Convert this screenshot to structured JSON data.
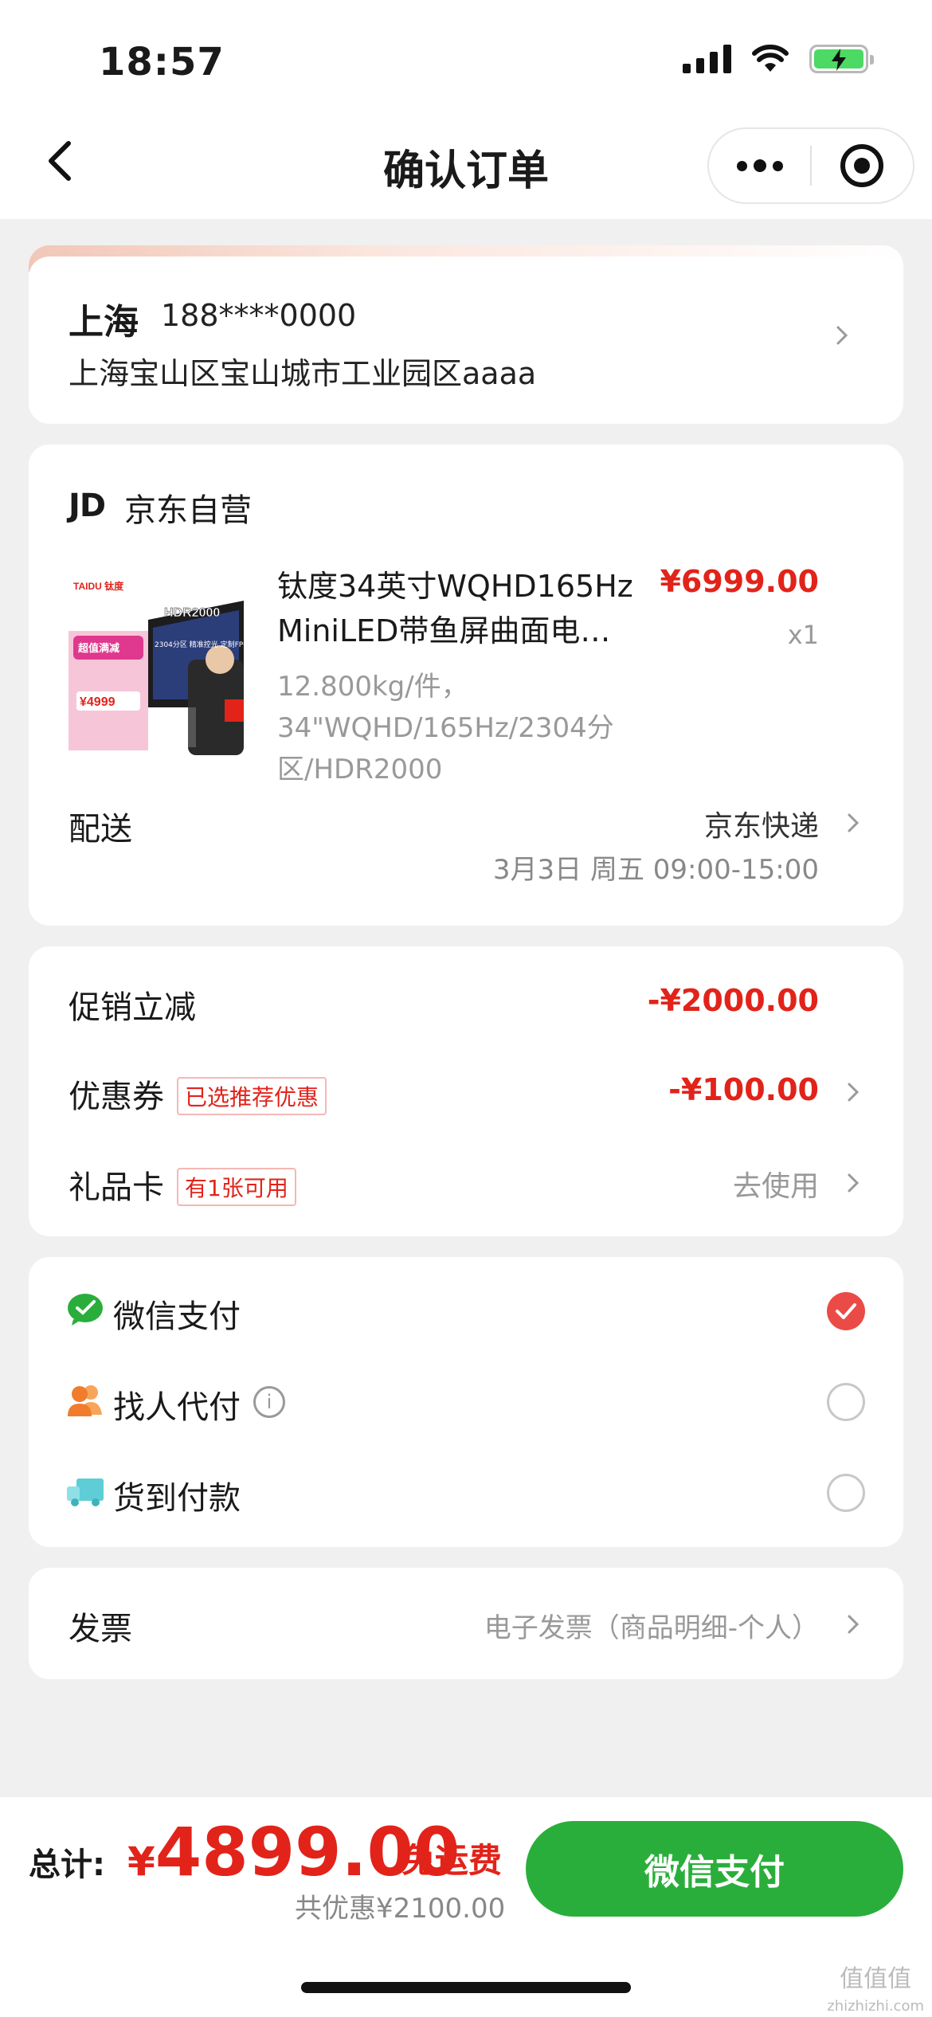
{
  "status_bar": {
    "time": "18:57"
  },
  "nav": {
    "title": "确认订单"
  },
  "address": {
    "city": "上海",
    "phone": "188****0000",
    "detail": "上海宝山区宝山城市工业园区aaaa"
  },
  "product": {
    "shop_logo": "JD",
    "shop_name": "京东自营",
    "title": "钛度34英寸WQHD165Hz MiniLED带鱼屏曲面电…",
    "price": "¥6999.00",
    "qty": "x1",
    "spec": "12.800kg/件，34\"WQHD/165Hz/2304分区/HDR2000",
    "thumb": {
      "brand": "TAIDU 钛度",
      "badge_top": "超值满减",
      "hdr": "HDR2000",
      "price": "¥4999",
      "caption": "2304分区 精准控光 定制FPGA控光单元"
    }
  },
  "delivery": {
    "label": "配送",
    "method": "京东快递",
    "time": "3月3日 周五 09:00-15:00"
  },
  "discounts": {
    "promo_label": "促销立减",
    "promo_value": "-¥2000.00",
    "coupon_label": "优惠券",
    "coupon_tag": "已选推荐优惠",
    "coupon_value": "-¥100.00",
    "giftcard_label": "礼品卡",
    "giftcard_tag": "有1张可用",
    "giftcard_value": "去使用"
  },
  "payment": {
    "options": [
      {
        "label": "微信支付",
        "icon": "wechat-pay-icon",
        "selected": true
      },
      {
        "label": "找人代付",
        "icon": "people-icon",
        "selected": false
      },
      {
        "label": "货到付款",
        "icon": "truck-icon",
        "selected": false
      }
    ],
    "info_glyph": "i"
  },
  "invoice": {
    "label": "发票",
    "value": "电子发票（商品明细-个人）"
  },
  "footer": {
    "total_label": "总计:",
    "currency": "¥",
    "total": "4899.00",
    "free_shipping": "免运费",
    "saved": "共优惠¥2100.00",
    "pay_button": "微信支付"
  },
  "watermark": {
    "main": "值值值",
    "sub": "zhizhizhi.com"
  },
  "colors": {
    "accent_red": "#e2231a",
    "pay_green": "#2aae3b",
    "radio_on": "#ea4b46"
  }
}
